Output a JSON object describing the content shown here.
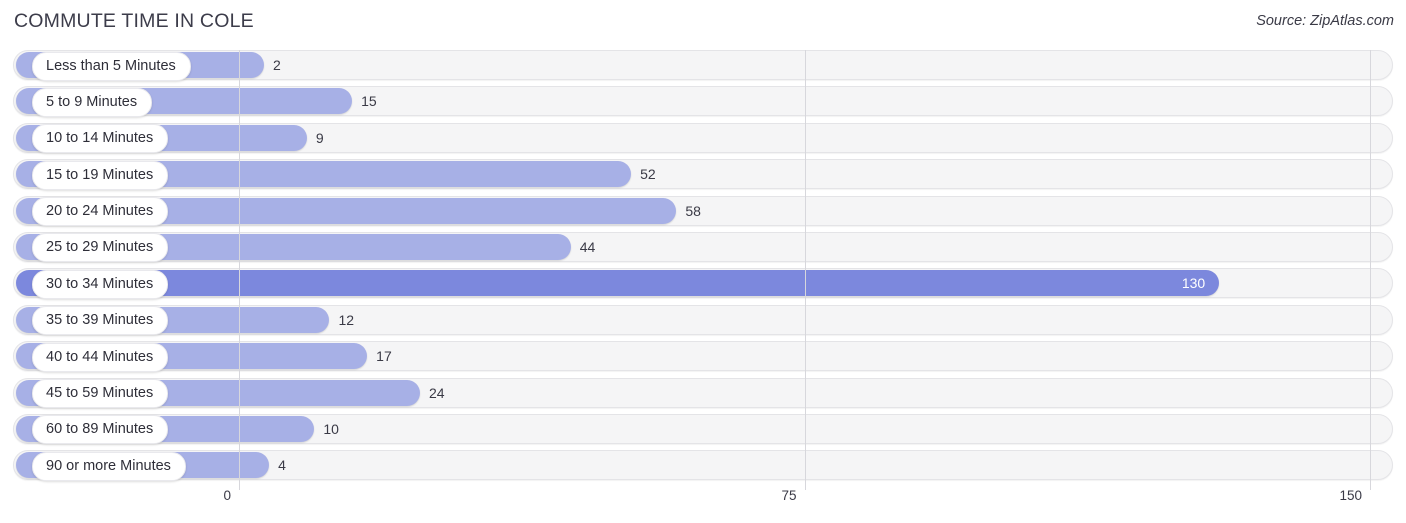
{
  "header": {
    "title": "COMMUTE TIME IN COLE",
    "source": "Source: ZipAtlas.com"
  },
  "chart_data": {
    "type": "bar",
    "orientation": "horizontal",
    "title": "COMMUTE TIME IN COLE",
    "xlabel": "",
    "ylabel": "",
    "xlim": [
      0,
      150
    ],
    "xticks": [
      0,
      75,
      150
    ],
    "xtick_labels": [
      "0",
      "75",
      "150"
    ],
    "grid": true,
    "legend": null,
    "categories": [
      "Less than 5 Minutes",
      "5 to 9 Minutes",
      "10 to 14 Minutes",
      "15 to 19 Minutes",
      "20 to 24 Minutes",
      "25 to 29 Minutes",
      "30 to 34 Minutes",
      "35 to 39 Minutes",
      "40 to 44 Minutes",
      "45 to 59 Minutes",
      "60 to 89 Minutes",
      "90 or more Minutes"
    ],
    "values": [
      2,
      15,
      9,
      52,
      58,
      44,
      130,
      12,
      17,
      24,
      10,
      4
    ],
    "value_labels": [
      "2",
      "15",
      "9",
      "52",
      "58",
      "44",
      "130",
      "12",
      "17",
      "24",
      "10",
      "4"
    ],
    "highlighted_category": "30 to 34 Minutes",
    "colors": {
      "bar": "#a7b0e6",
      "bar_highlight": "#7c88dd",
      "track": "#f5f5f6",
      "track_border": "#e4e4e7",
      "gridline": "#d7d7dc",
      "label_pill": "#ffffff",
      "text": "#3a3a46",
      "value_inside_text": "#ffffff"
    }
  }
}
